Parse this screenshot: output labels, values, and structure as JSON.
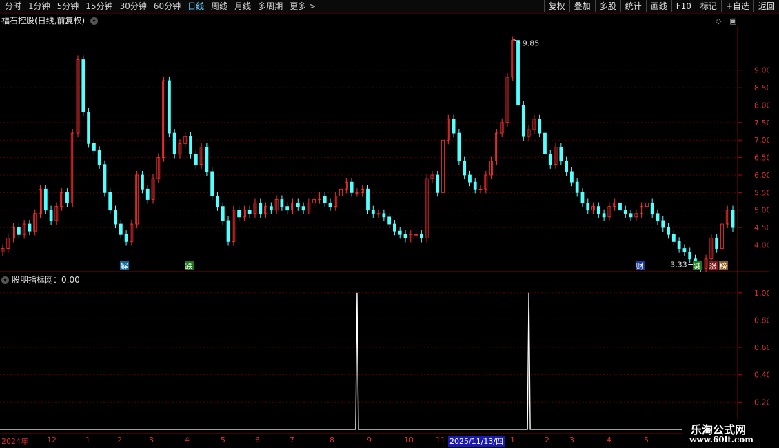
{
  "toolbar": {
    "periods": [
      "分时",
      "1分钟",
      "5分钟",
      "15分钟",
      "30分钟",
      "60分钟",
      "日线",
      "周线",
      "月线",
      "多周期",
      "更多 >"
    ],
    "active_period": "日线",
    "actions": [
      "复权",
      "叠加",
      "多股",
      "统计",
      "画线",
      "F10",
      "标记",
      "+自选",
      "返回"
    ]
  },
  "chart": {
    "title": "福石控股(日线,前复权)",
    "price_labels": [
      "9.00",
      "8.50",
      "8.00",
      "7.50",
      "7.00",
      "6.50",
      "6.00",
      "5.50",
      "5.00",
      "4.50",
      "4.00"
    ],
    "high_label": "9.85",
    "low_label": "3.33",
    "event_markers": [
      "解",
      "跌",
      "财",
      "减",
      "涨",
      "榜"
    ]
  },
  "indicator": {
    "title": "股朋指标网：0.00",
    "value_labels": [
      "1.00",
      "0.80",
      "0.60",
      "0.40",
      "0.20"
    ]
  },
  "xaxis": {
    "labels": [
      "2024年",
      "12",
      "1",
      "2",
      "3",
      "4",
      "5",
      "6",
      "7",
      "8",
      "9",
      "10",
      "11",
      "1",
      "2",
      "3",
      "4",
      "5"
    ],
    "cursor_date": "2025/11/13/四"
  },
  "watermark": {
    "line1": "乐淘公式网",
    "line2": "www.60lt.com"
  },
  "chart_data": {
    "type": "line",
    "title": "福石控股(日线,前复权)",
    "ylim": [
      3.3,
      10.0
    ],
    "series": [
      {
        "values": [
          3.9,
          4.2,
          4.5,
          4.3,
          4.6,
          4.4,
          4.9,
          5.6,
          5.0,
          4.7,
          5.1,
          5.5,
          5.2,
          7.2,
          9.3,
          7.8,
          6.9,
          6.7,
          6.3,
          5.5,
          5.0,
          4.6,
          4.3,
          4.1,
          4.6,
          6.0,
          5.6,
          5.3,
          5.9,
          6.5,
          8.7,
          7.2,
          6.6,
          6.9,
          7.1,
          6.6,
          6.3,
          6.8,
          6.1,
          5.4,
          5.1,
          4.7,
          4.1,
          5.0,
          4.8,
          5.0,
          4.9,
          5.2,
          4.9,
          5.1,
          5.0,
          5.3,
          5.1,
          5.0,
          5.2,
          5.1,
          5.0,
          5.2,
          5.3,
          5.4,
          5.2,
          5.1,
          5.4,
          5.6,
          5.8,
          5.5,
          5.5,
          5.6,
          5.0,
          4.9,
          4.9,
          4.8,
          4.6,
          4.4,
          4.3,
          4.2,
          4.3,
          4.3,
          4.2,
          5.9,
          6.0,
          5.5,
          7.0,
          7.6,
          7.2,
          6.4,
          6.0,
          5.8,
          5.6,
          5.6,
          6.0,
          6.4,
          7.2,
          7.5,
          8.8,
          9.85,
          8.0,
          7.1,
          7.3,
          7.6,
          7.2,
          6.6,
          6.3,
          6.8,
          6.4,
          6.1,
          5.8,
          5.5,
          5.2,
          5.0,
          5.1,
          4.9,
          4.8,
          5.1,
          5.2,
          5.0,
          4.9,
          4.8,
          4.9,
          5.1,
          5.2,
          4.9,
          4.7,
          4.5,
          4.3,
          4.1,
          3.9,
          3.8,
          3.6,
          3.4,
          3.33,
          3.6,
          4.2,
          3.9,
          4.6,
          5.0,
          4.5
        ]
      }
    ]
  },
  "indicator_data": {
    "type": "line",
    "ylim": [
      0,
      1.1
    ],
    "spikes_at": [
      66,
      98
    ]
  }
}
